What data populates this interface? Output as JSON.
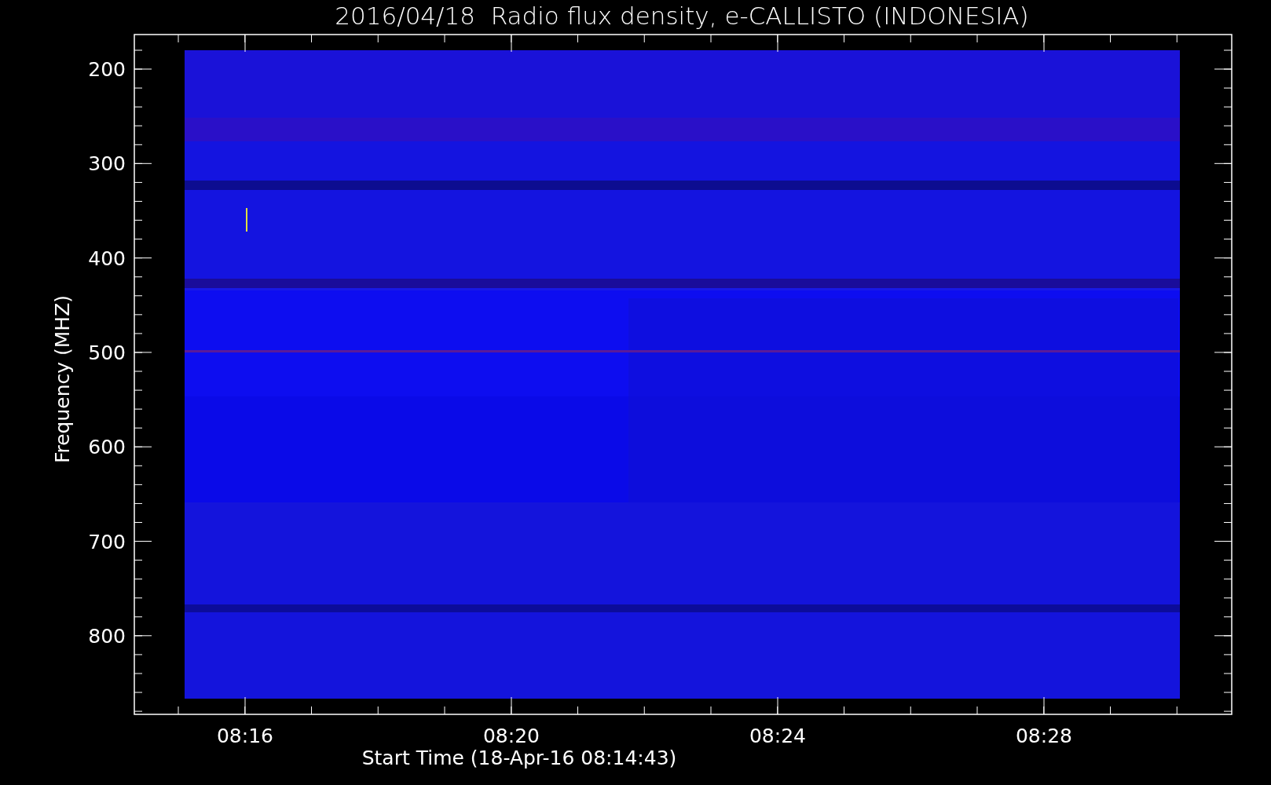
{
  "title": "2016/04/18  Radio flux density, e-CALLISTO (INDONESIA)",
  "plot": {
    "kind": "picture",
    "y_axis": {
      "label": "Frequency (MHZ)",
      "ticks": [
        "200",
        "300",
        "400",
        "500",
        "600",
        "700",
        "800"
      ]
    },
    "x_axis": {
      "label": "Start Time (18-Apr-16 08:14:43)",
      "ticks": [
        "08:16",
        "08:20",
        "08:24",
        "08:28"
      ]
    }
  }
}
